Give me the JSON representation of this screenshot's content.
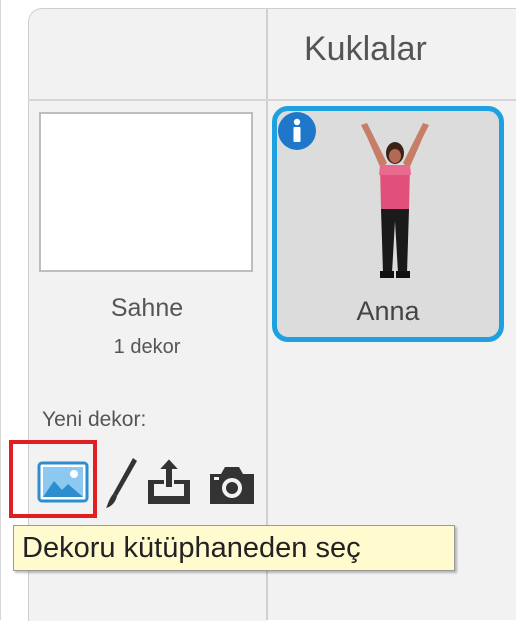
{
  "sprites_panel": {
    "title": "Kuklalar",
    "sprites": [
      {
        "name": "Anna",
        "selected": true,
        "info_icon": "info-icon"
      }
    ]
  },
  "stage_panel": {
    "name": "Sahne",
    "backdrop_count": "1 dekor",
    "new_backdrop_label": "Yeni dekor:",
    "tools": [
      {
        "icon": "image-library-icon",
        "highlighted": true
      },
      {
        "icon": "paintbrush-icon"
      },
      {
        "icon": "upload-icon"
      },
      {
        "icon": "camera-icon"
      }
    ],
    "tooltip": "Dekoru kütüphaneden seç"
  },
  "colors": {
    "selection_border": "#1fa0e0",
    "highlight_red": "#e02020",
    "tooltip_bg": "#fffbcf"
  }
}
